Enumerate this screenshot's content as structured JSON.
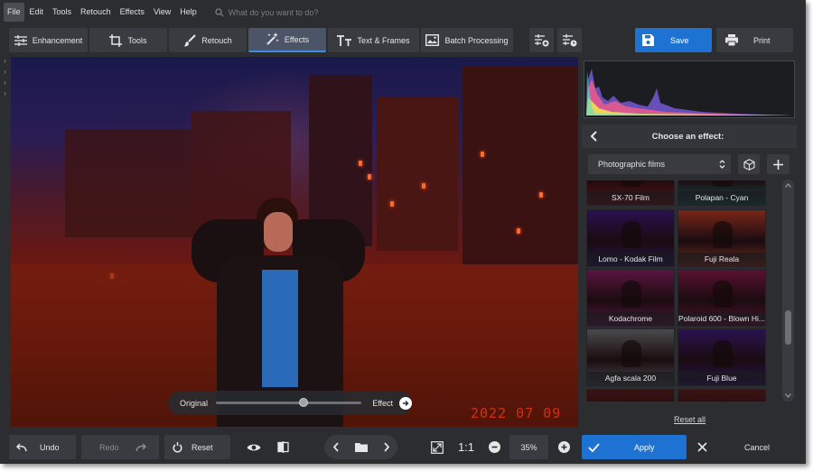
{
  "menu": [
    "File",
    "Edit",
    "Tools",
    "Retouch",
    "Effects",
    "View",
    "Help"
  ],
  "search_placeholder": "What do you want to do?",
  "tabs": [
    {
      "label": "Enhancement",
      "icon": "sliders-icon"
    },
    {
      "label": "Tools",
      "icon": "crop-icon"
    },
    {
      "label": "Retouch",
      "icon": "brush-icon"
    },
    {
      "label": "Effects",
      "icon": "magic-wand-icon"
    },
    {
      "label": "Text & Frames",
      "icon": "text-icon"
    },
    {
      "label": "Batch Processing",
      "icon": "image-stack-icon"
    }
  ],
  "active_tab": "Effects",
  "save_label": "Save",
  "print_label": "Print",
  "canvas": {
    "date_stamp": "2022 07 09",
    "slider_left": "Original",
    "slider_right": "Effect",
    "slider_value_pct": 60
  },
  "panel": {
    "title": "Choose an effect:",
    "category": "Photographic films",
    "effects": [
      {
        "label": "SX-70 Film",
        "tint": "#6a1010"
      },
      {
        "label": "Polapan - Cyan",
        "tint": "#1f4a4a"
      },
      {
        "label": "Lomo - Kodak Film",
        "tint": "#2a1050"
      },
      {
        "label": "Fuji Reala",
        "tint": "#7a2618"
      },
      {
        "label": "Kodachrome",
        "tint": "#5a1440"
      },
      {
        "label": "Polaroid 600 - Blown Hi...",
        "tint": "#5a1030"
      },
      {
        "label": "Agfa scala 200",
        "tint": "#4a4a4a"
      },
      {
        "label": "Fuji Blue",
        "tint": "#2a1250"
      }
    ],
    "reset_all": "Reset all"
  },
  "bottom": {
    "undo": "Undo",
    "redo": "Redo",
    "reset": "Reset",
    "ratio": "1:1",
    "zoom": "35%",
    "apply": "Apply",
    "cancel": "Cancel"
  },
  "colors": {
    "accent": "#1e73d2",
    "panel": "#2b2d31",
    "button": "#393b41"
  }
}
